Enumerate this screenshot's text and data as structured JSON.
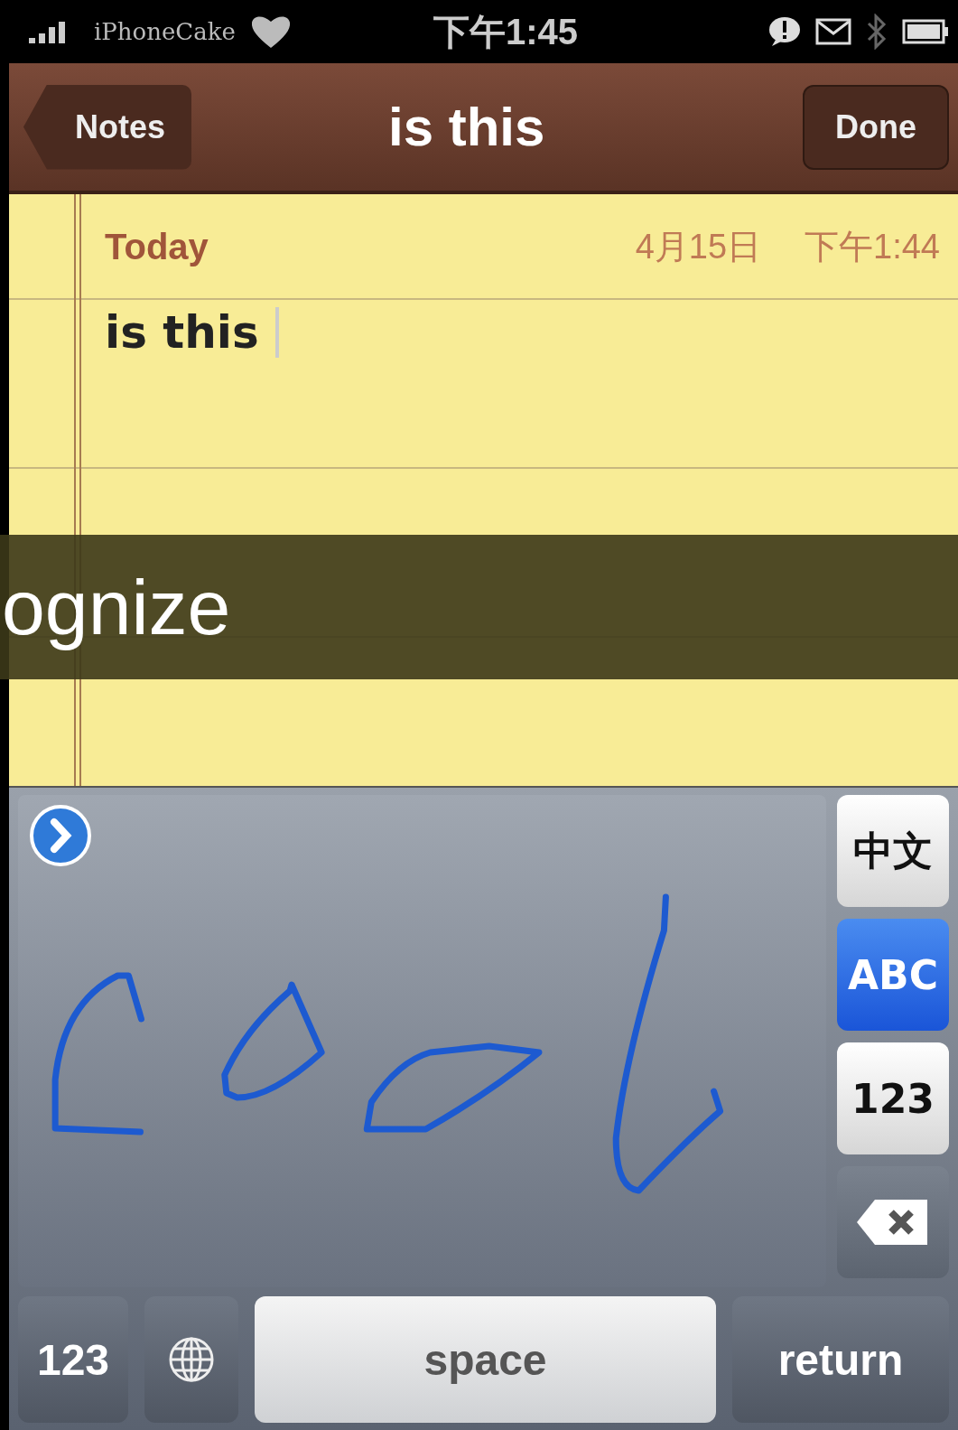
{
  "status_bar": {
    "carrier": "iPhoneCake",
    "time": "下午1:45"
  },
  "nav_bar": {
    "back_button": "Notes",
    "title": "is this",
    "done_button": "Done"
  },
  "note": {
    "day": "Today",
    "date": "4月15日",
    "time": "下午1:44",
    "text": "is this"
  },
  "caption": {
    "text": "ognize"
  },
  "keyboard": {
    "modes": [
      {
        "label": "中文",
        "selected": false
      },
      {
        "label": "ABC",
        "selected": true
      },
      {
        "label": "123",
        "selected": false
      }
    ],
    "bottom_keys": [
      {
        "kind": "text",
        "label": "123"
      },
      {
        "kind": "globe"
      },
      {
        "kind": "space",
        "label": "space"
      },
      {
        "kind": "text",
        "label": "return"
      }
    ]
  }
}
